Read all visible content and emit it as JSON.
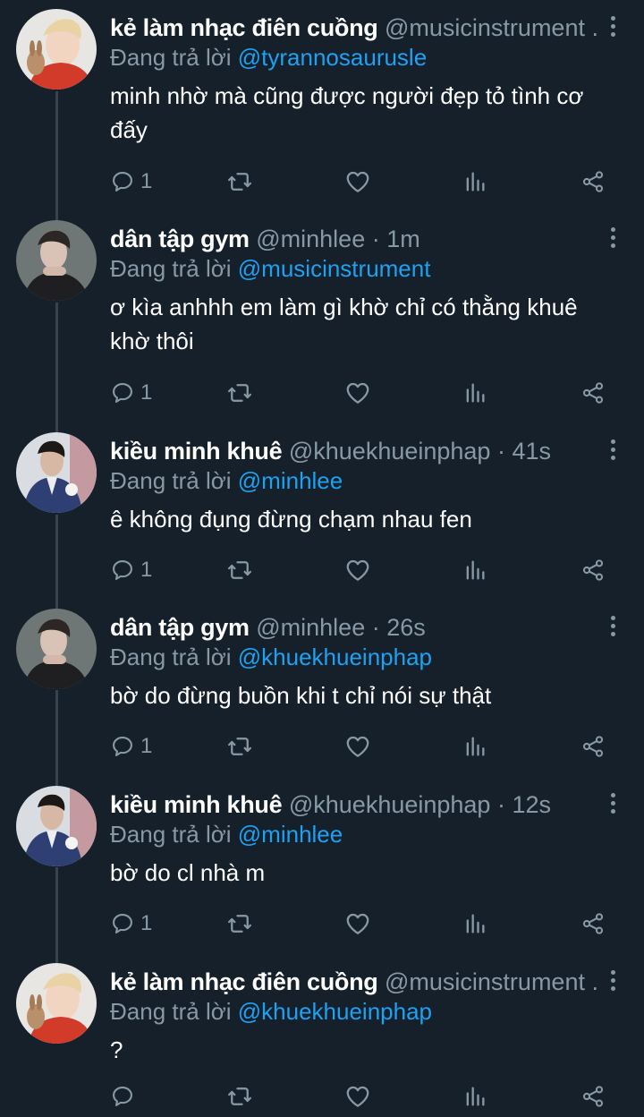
{
  "colors": {
    "background": "#15202b",
    "mention": "#1da1f2",
    "secondary_text": "#8899a6",
    "thread_line": "#38444d"
  },
  "tweets": [
    {
      "name": "kẻ làm nhạc điên cuồng",
      "handle_time": "@musicinstrument ...",
      "reply_prefix": "Đang trả lời ",
      "reply_mention": "@tyrannosaurusle",
      "text": "minh nhờ mà cũng được người đẹp tỏ tình cơ đấy",
      "reply_count": "1",
      "avatar": "avatar-red-shirt-rabbit"
    },
    {
      "name": "dân tập gym",
      "handle_time": "@minhlee · 1m",
      "reply_prefix": "Đang trả lời ",
      "reply_mention": "@musicinstrument",
      "text": "ơ kìa anhhh em làm gì khờ chỉ có thằng khuê khờ thôi",
      "reply_count": "1",
      "avatar": "avatar-dark-jacket"
    },
    {
      "name": "kiều minh khuê",
      "handle_time": "@khuekhueinphap · 41s",
      "reply_prefix": "Đang trả lời ",
      "reply_mention": "@minhlee",
      "text": "ê không đụng đừng chạm nhau fen",
      "reply_count": "1",
      "avatar": "avatar-blue-suit"
    },
    {
      "name": "dân tập gym",
      "handle_time": "@minhlee · 26s",
      "reply_prefix": "Đang trả lời ",
      "reply_mention": "@khuekhueinphap",
      "text": "bờ do đừng buồn khi t chỉ nói sự thật",
      "reply_count": "1",
      "avatar": "avatar-dark-jacket"
    },
    {
      "name": "kiều minh khuê",
      "handle_time": "@khuekhueinphap · 12s",
      "reply_prefix": "Đang trả lời ",
      "reply_mention": "@minhlee",
      "text": "bờ do cl nhà m",
      "reply_count": "1",
      "avatar": "avatar-blue-suit"
    },
    {
      "name": "kẻ làm nhạc điên cuồng",
      "handle_time": "@musicinstrument ...",
      "reply_prefix": "Đang trả lời ",
      "reply_mention": "@khuekhueinphap",
      "text": "?",
      "reply_count": "",
      "avatar": "avatar-red-shirt-rabbit"
    }
  ],
  "icons": {
    "reply": "reply-icon",
    "retweet": "retweet-icon",
    "like": "heart-icon",
    "analytics": "analytics-icon",
    "share": "share-icon",
    "more": "more-vertical-icon"
  }
}
